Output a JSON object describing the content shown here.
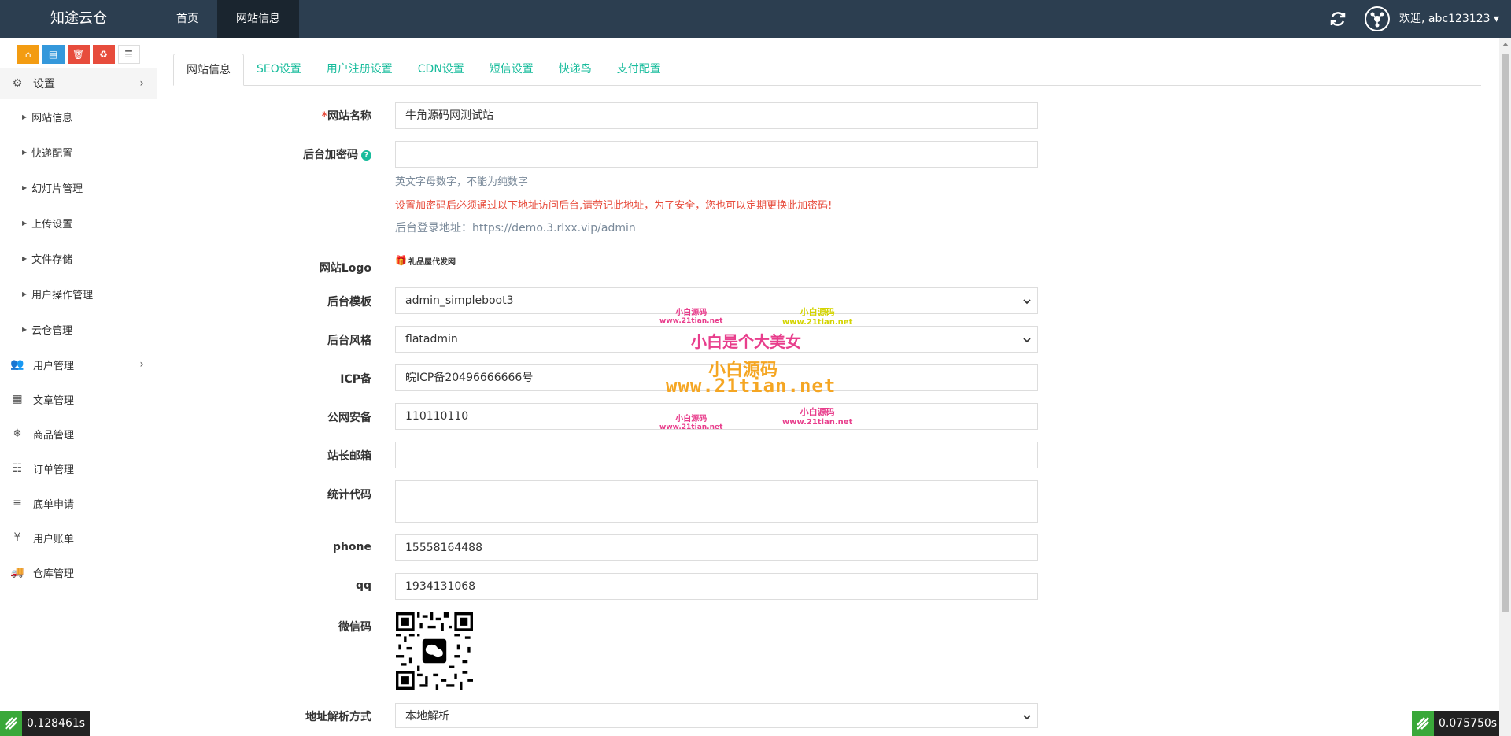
{
  "header": {
    "brand": "知途云仓",
    "nav": [
      "首页",
      "网站信息"
    ],
    "welcome": "欢迎, abc123123"
  },
  "sidebar": {
    "section_settings": "设置",
    "settings_items": [
      "网站信息",
      "快递配置",
      "幻灯片管理",
      "上传设置",
      "文件存储",
      "用户操作管理",
      "云仓管理"
    ],
    "menu": [
      {
        "label": "用户管理",
        "icon": "users-icon",
        "has_children": true
      },
      {
        "label": "文章管理",
        "icon": "newspaper-icon",
        "has_children": false
      },
      {
        "label": "商品管理",
        "icon": "snowflake-icon",
        "has_children": false
      },
      {
        "label": "订单管理",
        "icon": "server-icon",
        "has_children": false
      },
      {
        "label": "底单申请",
        "icon": "bars-icon",
        "has_children": false
      },
      {
        "label": "用户账单",
        "icon": "yen-icon",
        "has_children": false
      },
      {
        "label": "仓库管理",
        "icon": "truck-icon",
        "has_children": false
      }
    ]
  },
  "tabs": [
    "网站信息",
    "SEO设置",
    "用户注册设置",
    "CDN设置",
    "短信设置",
    "快递鸟",
    "支付配置"
  ],
  "form": {
    "site_name_label": "网站名称",
    "site_name_value": "牛角源码网测试站",
    "admin_pwd_label": "后台加密码",
    "admin_pwd_hint": "英文字母数字，不能为纯数字",
    "admin_pwd_warning": "设置加密码后必须通过以下地址访问后台,请劳记此地址，为了安全，您也可以定期更换此加密码!",
    "admin_login_url": "后台登录地址：https://demo.3.rlxx.vip/admin",
    "logo_label": "网站Logo",
    "logo_text": "礼品屋代发网",
    "template_label": "后台模板",
    "template_value": "admin_simpleboot3",
    "style_label": "后台风格",
    "style_value": "flatadmin",
    "icp_label": "ICP备",
    "icp_value": "皖ICP备20496666666号",
    "police_label": "公网安备",
    "police_value": "110110110",
    "email_label": "站长邮箱",
    "email_value": "",
    "stats_label": "统计代码",
    "stats_value": "",
    "phone_label": "phone",
    "phone_value": "15558164488",
    "qq_label": "qq",
    "qq_value": "1934131068",
    "wechat_label": "微信码",
    "resolve_label": "地址解析方式",
    "resolve_value": "本地解析"
  },
  "watermarks": {
    "small_pink": "小白源码",
    "small_pink_url": "www.21tian.net",
    "small_yellow": "小白源码",
    "small_yellow_url": "www.21tian.net",
    "large_pink": "小白是个大美女",
    "large_orange": "小白源码",
    "large_orange_url": "www.21tian.net"
  },
  "timers": {
    "left": "0.128461s",
    "right": "0.075750s"
  },
  "colors": {
    "topbar": "#2c3e50",
    "accent": "#18bc9c",
    "danger": "#e74c3c"
  }
}
